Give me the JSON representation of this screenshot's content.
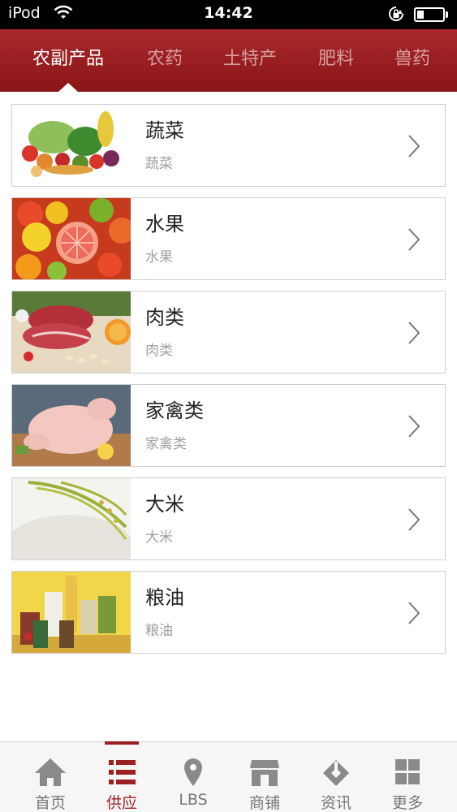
{
  "status_bar": {
    "carrier": "iPod",
    "time": "14:42"
  },
  "tabs": [
    {
      "label": "农副产品",
      "active": true
    },
    {
      "label": "农药",
      "active": false
    },
    {
      "label": "土特产",
      "active": false
    },
    {
      "label": "肥料",
      "active": false
    },
    {
      "label": "兽药",
      "active": false
    }
  ],
  "items": [
    {
      "title": "蔬菜",
      "subtitle": "蔬菜",
      "image": "vegetables-image"
    },
    {
      "title": "水果",
      "subtitle": "水果",
      "image": "fruits-image"
    },
    {
      "title": "肉类",
      "subtitle": "肉类",
      "image": "meat-image"
    },
    {
      "title": "家禽类",
      "subtitle": "家禽类",
      "image": "poultry-image"
    },
    {
      "title": "大米",
      "subtitle": "大米",
      "image": "rice-image"
    },
    {
      "title": "粮油",
      "subtitle": "粮油",
      "image": "grain-oil-image"
    }
  ],
  "bottom_nav": [
    {
      "label": "首页",
      "icon": "home-icon",
      "active": false
    },
    {
      "label": "供应",
      "icon": "list-icon",
      "active": true
    },
    {
      "label": "LBS",
      "icon": "location-pin-icon",
      "active": false
    },
    {
      "label": "商铺",
      "icon": "shop-icon",
      "active": false
    },
    {
      "label": "资讯",
      "icon": "news-icon",
      "active": false
    },
    {
      "label": "更多",
      "icon": "grid-icon",
      "active": false
    }
  ],
  "colors": {
    "brand": "#9c1f22",
    "tab_inactive": "#d89ea0",
    "subtitle": "#a0a0a0",
    "nav_icon": "#8a8a8a"
  }
}
